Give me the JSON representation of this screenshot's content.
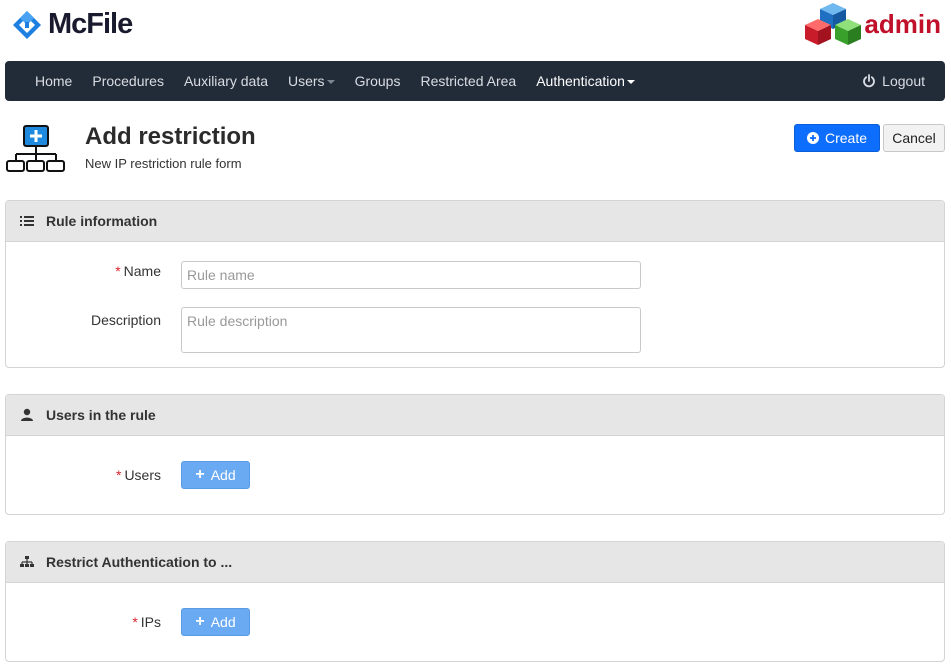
{
  "brand": {
    "name": "McFile",
    "admin_label": "admin"
  },
  "nav": {
    "items": [
      {
        "label": "Home"
      },
      {
        "label": "Procedures"
      },
      {
        "label": "Auxiliary data"
      },
      {
        "label": "Users"
      },
      {
        "label": "Groups"
      },
      {
        "label": "Restricted Area"
      },
      {
        "label": "Authentication"
      }
    ],
    "logout_label": "Logout"
  },
  "page": {
    "title": "Add restriction",
    "subtitle": "New IP restriction rule form",
    "create_label": "Create",
    "cancel_label": "Cancel"
  },
  "rule_info": {
    "title": "Rule information",
    "name_label": "Name",
    "name_placeholder": "Rule name",
    "name_value": "",
    "description_label": "Description",
    "description_placeholder": "Rule description",
    "description_value": ""
  },
  "users_panel": {
    "title": "Users in the rule",
    "users_label": "Users",
    "add_label": "Add"
  },
  "auth_panel": {
    "title": "Restrict Authentication to ...",
    "ips_label": "IPs",
    "add_label": "Add"
  },
  "colors": {
    "navbar": "#222b38",
    "primary": "#0d6efd",
    "add_button": "#6aaaf2",
    "required": "#d9232e",
    "admin": "#c0102a"
  },
  "icons": {
    "brand": "mcfile-logo-icon",
    "admin": "admin-cubes-logo",
    "logout": "power-icon",
    "page": "network-add-icon",
    "rule_info": "list-icon",
    "users": "user-icon",
    "auth": "sitemap-icon"
  }
}
